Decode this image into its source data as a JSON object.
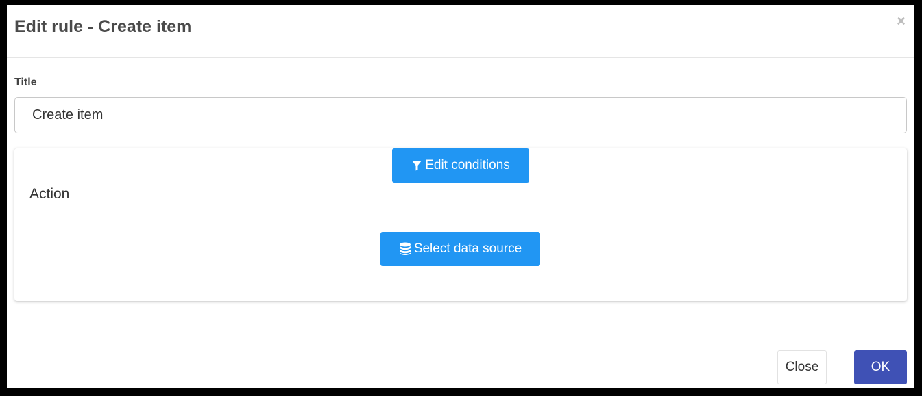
{
  "dialog": {
    "title": "Edit rule - Create item",
    "close_glyph": "×"
  },
  "form": {
    "title_label": "Title",
    "title_value": "Create item"
  },
  "rule_card": {
    "edit_conditions_label": "Edit conditions",
    "edit_conditions_icon": "filter-icon",
    "action_label": "Action",
    "select_data_source_label": "Select data source",
    "select_data_source_icon": "database-icon"
  },
  "footer": {
    "close_label": "Close",
    "ok_label": "OK"
  },
  "colors": {
    "primary_blue": "#2196f3",
    "ok_indigo": "#3f51b5"
  }
}
